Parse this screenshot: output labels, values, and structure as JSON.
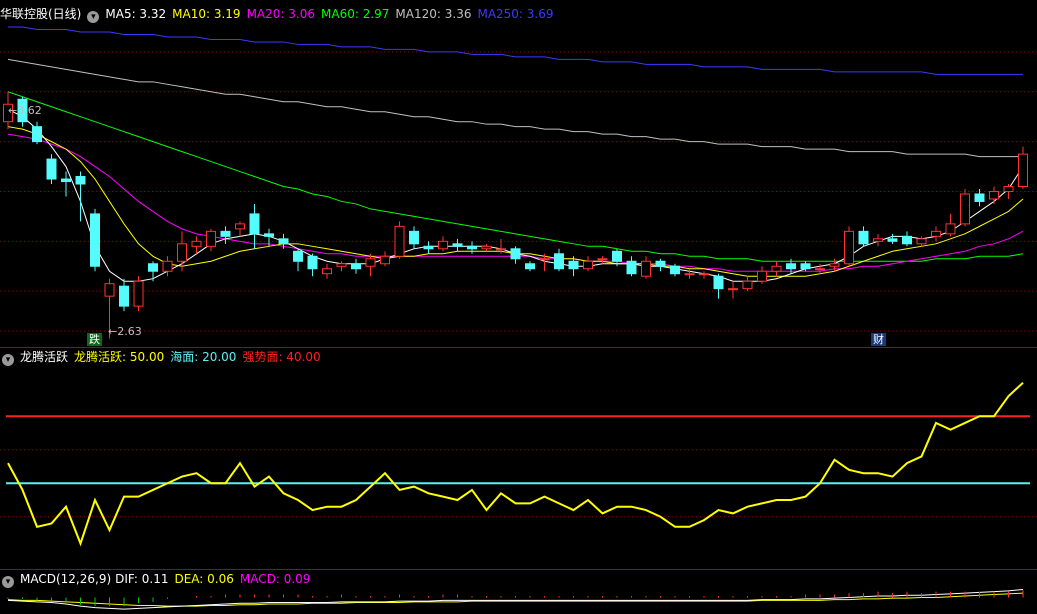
{
  "main_header": {
    "stock": "华联控股(日线)",
    "ma": [
      {
        "label": "MA5: 3.32",
        "color": "#ffffff"
      },
      {
        "label": "MA10: 3.19",
        "color": "#ffff00"
      },
      {
        "label": "MA20: 3.06",
        "color": "#ff00ff"
      },
      {
        "label": "MA60: 2.97",
        "color": "#00ff00"
      },
      {
        "label": "MA120: 3.36",
        "color": "#c0c0c0"
      },
      {
        "label": "MA250: 3.69",
        "color": "#3a3aff"
      }
    ]
  },
  "price_marks": {
    "high_label": "3.62",
    "low_label": "2.63"
  },
  "event_tags": {
    "left": "跌",
    "right": "财"
  },
  "indicator_header": {
    "name": "龙腾活跃",
    "items": [
      {
        "label": "龙腾活跃: 50.00",
        "color": "#ffff00"
      },
      {
        "label": "海面: 20.00",
        "color": "#5ef0f0"
      },
      {
        "label": "强势面: 40.00",
        "color": "#ff2020"
      }
    ]
  },
  "macd_header": {
    "name": "MACD(12,26,9)",
    "items": [
      {
        "label": "DIF: 0.11",
        "color": "#ffffff"
      },
      {
        "label": "DEA: 0.06",
        "color": "#ffff00"
      },
      {
        "label": "MACD: 0.09",
        "color": "#ff00ff"
      }
    ]
  },
  "colors": {
    "up": "#ff3232",
    "down": "#54fcfc",
    "grid": "#8b0000",
    "sea": "#5ef0f0",
    "strong": "#ff2020",
    "active": "#ffff00"
  },
  "chart_data": [
    {
      "type": "candlestick",
      "title": "华联控股(日线)",
      "ylim": [
        2.6,
        3.9
      ],
      "high_mark": 3.62,
      "low_mark": 2.63,
      "candles": [
        [
          3.5,
          3.57,
          3.62,
          3.47
        ],
        [
          3.59,
          3.5,
          3.6,
          3.48
        ],
        [
          3.48,
          3.42,
          3.5,
          3.41
        ],
        [
          3.35,
          3.27,
          3.37,
          3.25
        ],
        [
          3.27,
          3.26,
          3.3,
          3.2
        ],
        [
          3.28,
          3.25,
          3.3,
          3.1
        ],
        [
          3.13,
          2.92,
          3.15,
          2.9
        ],
        [
          2.8,
          2.85,
          2.87,
          2.63
        ],
        [
          2.84,
          2.76,
          2.87,
          2.74
        ],
        [
          2.76,
          2.86,
          2.88,
          2.74
        ],
        [
          2.93,
          2.9,
          2.94,
          2.86
        ],
        [
          2.9,
          2.94,
          2.96,
          2.88
        ],
        [
          2.94,
          3.01,
          3.06,
          2.9
        ],
        [
          3.0,
          3.02,
          3.04,
          2.97
        ],
        [
          3.0,
          3.06,
          3.07,
          2.98
        ],
        [
          3.06,
          3.04,
          3.08,
          3.01
        ],
        [
          3.07,
          3.09,
          3.1,
          3.04
        ],
        [
          3.13,
          3.05,
          3.17,
          2.99
        ],
        [
          3.05,
          3.04,
          3.07,
          3.0
        ],
        [
          3.03,
          3.01,
          3.05,
          2.99
        ],
        [
          2.98,
          2.94,
          2.99,
          2.9
        ],
        [
          2.96,
          2.91,
          2.97,
          2.88
        ],
        [
          2.89,
          2.91,
          2.93,
          2.87
        ],
        [
          2.92,
          2.93,
          2.94,
          2.9
        ],
        [
          2.93,
          2.91,
          2.95,
          2.89
        ],
        [
          2.92,
          2.95,
          2.97,
          2.88
        ],
        [
          2.93,
          2.96,
          2.98,
          2.92
        ],
        [
          2.96,
          3.08,
          3.1,
          2.95
        ],
        [
          3.06,
          3.01,
          3.08,
          2.99
        ],
        [
          3.0,
          2.99,
          3.02,
          2.97
        ],
        [
          2.99,
          3.02,
          3.04,
          2.98
        ],
        [
          3.01,
          3.0,
          3.03,
          2.98
        ],
        [
          3.0,
          2.99,
          3.02,
          2.97
        ],
        [
          2.99,
          3.0,
          3.01,
          2.98
        ],
        [
          2.99,
          2.99,
          3.03,
          2.97
        ],
        [
          2.99,
          2.95,
          3.0,
          2.93
        ],
        [
          2.93,
          2.91,
          2.94,
          2.9
        ],
        [
          2.95,
          2.95,
          2.97,
          2.9
        ],
        [
          2.97,
          2.91,
          2.99,
          2.9
        ],
        [
          2.94,
          2.91,
          2.96,
          2.88
        ],
        [
          2.91,
          2.94,
          2.96,
          2.9
        ],
        [
          2.95,
          2.95,
          2.96,
          2.93
        ],
        [
          2.98,
          2.94,
          2.99,
          2.92
        ],
        [
          2.94,
          2.89,
          2.96,
          2.88
        ],
        [
          2.88,
          2.94,
          2.96,
          2.87
        ],
        [
          2.94,
          2.92,
          2.95,
          2.9
        ],
        [
          2.92,
          2.89,
          2.93,
          2.88
        ],
        [
          2.89,
          2.89,
          2.91,
          2.87
        ],
        [
          2.89,
          2.89,
          2.9,
          2.87
        ],
        [
          2.88,
          2.83,
          2.89,
          2.79
        ],
        [
          2.83,
          2.83,
          2.86,
          2.79
        ],
        [
          2.83,
          2.86,
          2.88,
          2.82
        ],
        [
          2.86,
          2.9,
          2.92,
          2.85
        ],
        [
          2.9,
          2.92,
          2.94,
          2.88
        ],
        [
          2.93,
          2.91,
          2.95,
          2.89
        ],
        [
          2.93,
          2.91,
          2.94,
          2.9
        ],
        [
          2.91,
          2.91,
          2.93,
          2.89
        ],
        [
          2.92,
          2.93,
          2.95,
          2.9
        ],
        [
          2.93,
          3.06,
          3.08,
          2.92
        ],
        [
          3.06,
          3.01,
          3.08,
          3.0
        ],
        [
          3.02,
          3.03,
          3.05,
          3.0
        ],
        [
          3.03,
          3.02,
          3.05,
          3.01
        ],
        [
          3.04,
          3.01,
          3.06,
          3.0
        ],
        [
          3.01,
          3.03,
          3.04,
          3.0
        ],
        [
          3.04,
          3.06,
          3.08,
          3.02
        ],
        [
          3.05,
          3.09,
          3.13,
          3.04
        ],
        [
          3.09,
          3.21,
          3.23,
          3.08
        ],
        [
          3.21,
          3.18,
          3.23,
          3.16
        ],
        [
          3.19,
          3.22,
          3.24,
          3.17
        ],
        [
          3.22,
          3.24,
          3.25,
          3.19
        ],
        [
          3.24,
          3.37,
          3.4,
          3.23
        ]
      ],
      "ma": {
        "MA5": [
          3.55,
          3.52,
          3.47,
          3.4,
          3.32,
          3.18,
          3.0,
          2.9,
          2.86,
          2.86,
          2.87,
          2.9,
          2.93,
          2.97,
          3.01,
          3.03,
          3.04,
          3.05,
          3.04,
          3.02,
          2.99,
          2.96,
          2.94,
          2.93,
          2.93,
          2.93,
          2.95,
          2.97,
          2.99,
          3.0,
          3.0,
          3.0,
          3.0,
          3.0,
          2.99,
          2.97,
          2.96,
          2.94,
          2.93,
          2.92,
          2.92,
          2.93,
          2.93,
          2.93,
          2.92,
          2.92,
          2.91,
          2.9,
          2.89,
          2.88,
          2.86,
          2.86,
          2.86,
          2.87,
          2.89,
          2.91,
          2.92,
          2.93,
          2.96,
          3.0,
          3.02,
          3.04,
          3.04,
          3.03,
          3.04,
          3.06,
          3.1,
          3.14,
          3.18,
          3.23,
          3.32
        ],
        "MA10": [
          3.48,
          3.47,
          3.45,
          3.42,
          3.39,
          3.34,
          3.27,
          3.18,
          3.09,
          3.01,
          2.96,
          2.93,
          2.92,
          2.93,
          2.94,
          2.96,
          2.98,
          2.99,
          3.0,
          3.01,
          3.01,
          3.0,
          2.99,
          2.98,
          2.97,
          2.96,
          2.95,
          2.96,
          2.96,
          2.97,
          2.97,
          2.98,
          2.98,
          2.98,
          2.98,
          2.97,
          2.97,
          2.96,
          2.95,
          2.95,
          2.94,
          2.94,
          2.93,
          2.93,
          2.93,
          2.92,
          2.92,
          2.91,
          2.91,
          2.9,
          2.89,
          2.88,
          2.88,
          2.88,
          2.88,
          2.88,
          2.89,
          2.9,
          2.92,
          2.94,
          2.96,
          2.98,
          2.99,
          3.0,
          3.01,
          3.03,
          3.05,
          3.08,
          3.11,
          3.14,
          3.19
        ],
        "MA20": [
          3.45,
          3.44,
          3.43,
          3.41,
          3.39,
          3.36,
          3.32,
          3.28,
          3.23,
          3.18,
          3.14,
          3.1,
          3.07,
          3.05,
          3.04,
          3.03,
          3.02,
          3.01,
          3.01,
          3.0,
          2.99,
          2.98,
          2.97,
          2.97,
          2.96,
          2.96,
          2.96,
          2.96,
          2.96,
          2.96,
          2.96,
          2.96,
          2.96,
          2.96,
          2.96,
          2.96,
          2.96,
          2.95,
          2.95,
          2.95,
          2.94,
          2.94,
          2.94,
          2.93,
          2.93,
          2.93,
          2.92,
          2.92,
          2.91,
          2.91,
          2.9,
          2.9,
          2.9,
          2.9,
          2.9,
          2.9,
          2.9,
          2.91,
          2.91,
          2.92,
          2.92,
          2.93,
          2.94,
          2.95,
          2.96,
          2.97,
          2.98,
          3.0,
          3.01,
          3.03,
          3.06
        ],
        "MA60": [
          3.62,
          3.6,
          3.58,
          3.56,
          3.54,
          3.52,
          3.5,
          3.48,
          3.46,
          3.44,
          3.42,
          3.4,
          3.38,
          3.36,
          3.34,
          3.32,
          3.3,
          3.28,
          3.26,
          3.24,
          3.23,
          3.21,
          3.2,
          3.18,
          3.17,
          3.15,
          3.14,
          3.13,
          3.12,
          3.11,
          3.1,
          3.09,
          3.08,
          3.07,
          3.06,
          3.05,
          3.04,
          3.03,
          3.02,
          3.01,
          3.0,
          3.0,
          2.99,
          2.98,
          2.98,
          2.97,
          2.97,
          2.96,
          2.96,
          2.95,
          2.95,
          2.95,
          2.94,
          2.94,
          2.94,
          2.94,
          2.94,
          2.94,
          2.94,
          2.94,
          2.94,
          2.94,
          2.94,
          2.94,
          2.95,
          2.95,
          2.95,
          2.96,
          2.96,
          2.96,
          2.97
        ],
        "MA120": [
          3.75,
          3.74,
          3.73,
          3.72,
          3.71,
          3.7,
          3.69,
          3.68,
          3.67,
          3.66,
          3.66,
          3.65,
          3.64,
          3.63,
          3.62,
          3.61,
          3.61,
          3.6,
          3.59,
          3.58,
          3.58,
          3.57,
          3.56,
          3.56,
          3.55,
          3.54,
          3.54,
          3.53,
          3.52,
          3.52,
          3.51,
          3.5,
          3.5,
          3.49,
          3.49,
          3.48,
          3.48,
          3.47,
          3.47,
          3.46,
          3.46,
          3.45,
          3.45,
          3.44,
          3.44,
          3.43,
          3.43,
          3.42,
          3.42,
          3.41,
          3.41,
          3.41,
          3.4,
          3.4,
          3.4,
          3.39,
          3.39,
          3.39,
          3.38,
          3.38,
          3.38,
          3.38,
          3.37,
          3.37,
          3.37,
          3.37,
          3.37,
          3.36,
          3.36,
          3.36,
          3.36
        ],
        "MA250": [
          3.88,
          3.88,
          3.87,
          3.87,
          3.87,
          3.86,
          3.86,
          3.86,
          3.85,
          3.85,
          3.85,
          3.84,
          3.84,
          3.84,
          3.83,
          3.83,
          3.83,
          3.82,
          3.82,
          3.82,
          3.81,
          3.81,
          3.81,
          3.8,
          3.8,
          3.8,
          3.79,
          3.79,
          3.79,
          3.78,
          3.78,
          3.78,
          3.77,
          3.77,
          3.77,
          3.76,
          3.76,
          3.76,
          3.75,
          3.75,
          3.75,
          3.74,
          3.74,
          3.74,
          3.73,
          3.73,
          3.73,
          3.73,
          3.72,
          3.72,
          3.72,
          3.72,
          3.71,
          3.71,
          3.71,
          3.71,
          3.71,
          3.7,
          3.7,
          3.7,
          3.7,
          3.7,
          3.7,
          3.7,
          3.69,
          3.69,
          3.69,
          3.69,
          3.69,
          3.69,
          3.69
        ]
      }
    },
    {
      "type": "line",
      "title": "龙腾活跃",
      "ylim": [
        -5,
        55
      ],
      "levels": {
        "sea": 20.0,
        "strong": 40.0
      },
      "series": [
        {
          "name": "龙腾活跃",
          "values": [
            26,
            18,
            7,
            8,
            13,
            2,
            15,
            6,
            16,
            16,
            18,
            20,
            22,
            23,
            20,
            20,
            26,
            19,
            22,
            17,
            15,
            12,
            13,
            13,
            15,
            19,
            23,
            18,
            19,
            17,
            16,
            15,
            18,
            12,
            17,
            14,
            14,
            16,
            14,
            12,
            15,
            11,
            13,
            13,
            12,
            10,
            7,
            7,
            9,
            12,
            11,
            13,
            14,
            15,
            15,
            16,
            20,
            27,
            24,
            23,
            23,
            22,
            26,
            28,
            38,
            36,
            38,
            40,
            40,
            46,
            50
          ]
        }
      ]
    },
    {
      "type": "line",
      "title": "MACD(12,26,9)",
      "ylim": [
        -0.2,
        0.13
      ],
      "series": [
        {
          "name": "DIF",
          "values": [
            -0.04,
            -0.05,
            -0.06,
            -0.07,
            -0.09,
            -0.12,
            -0.14,
            -0.15,
            -0.16,
            -0.15,
            -0.14,
            -0.13,
            -0.12,
            -0.11,
            -0.1,
            -0.09,
            -0.08,
            -0.08,
            -0.07,
            -0.07,
            -0.07,
            -0.07,
            -0.07,
            -0.06,
            -0.06,
            -0.06,
            -0.06,
            -0.05,
            -0.05,
            -0.05,
            -0.04,
            -0.04,
            -0.04,
            -0.04,
            -0.04,
            -0.04,
            -0.04,
            -0.04,
            -0.04,
            -0.04,
            -0.04,
            -0.04,
            -0.04,
            -0.04,
            -0.04,
            -0.04,
            -0.04,
            -0.04,
            -0.04,
            -0.04,
            -0.04,
            -0.04,
            -0.03,
            -0.03,
            -0.03,
            -0.02,
            -0.02,
            -0.01,
            0.0,
            0.01,
            0.02,
            0.02,
            0.03,
            0.03,
            0.04,
            0.05,
            0.06,
            0.07,
            0.08,
            0.09,
            0.11
          ]
        },
        {
          "name": "DEA",
          "values": [
            -0.03,
            -0.04,
            -0.04,
            -0.05,
            -0.06,
            -0.07,
            -0.08,
            -0.09,
            -0.1,
            -0.11,
            -0.11,
            -0.12,
            -0.12,
            -0.12,
            -0.11,
            -0.11,
            -0.1,
            -0.1,
            -0.09,
            -0.09,
            -0.09,
            -0.08,
            -0.08,
            -0.08,
            -0.07,
            -0.07,
            -0.07,
            -0.07,
            -0.06,
            -0.06,
            -0.06,
            -0.06,
            -0.05,
            -0.05,
            -0.05,
            -0.05,
            -0.05,
            -0.05,
            -0.05,
            -0.05,
            -0.05,
            -0.05,
            -0.05,
            -0.05,
            -0.05,
            -0.05,
            -0.05,
            -0.05,
            -0.05,
            -0.05,
            -0.05,
            -0.05,
            -0.04,
            -0.04,
            -0.04,
            -0.04,
            -0.04,
            -0.03,
            -0.03,
            -0.02,
            -0.02,
            -0.01,
            -0.01,
            0.0,
            0.0,
            0.01,
            0.02,
            0.03,
            0.04,
            0.05,
            0.06
          ]
        }
      ]
    }
  ]
}
